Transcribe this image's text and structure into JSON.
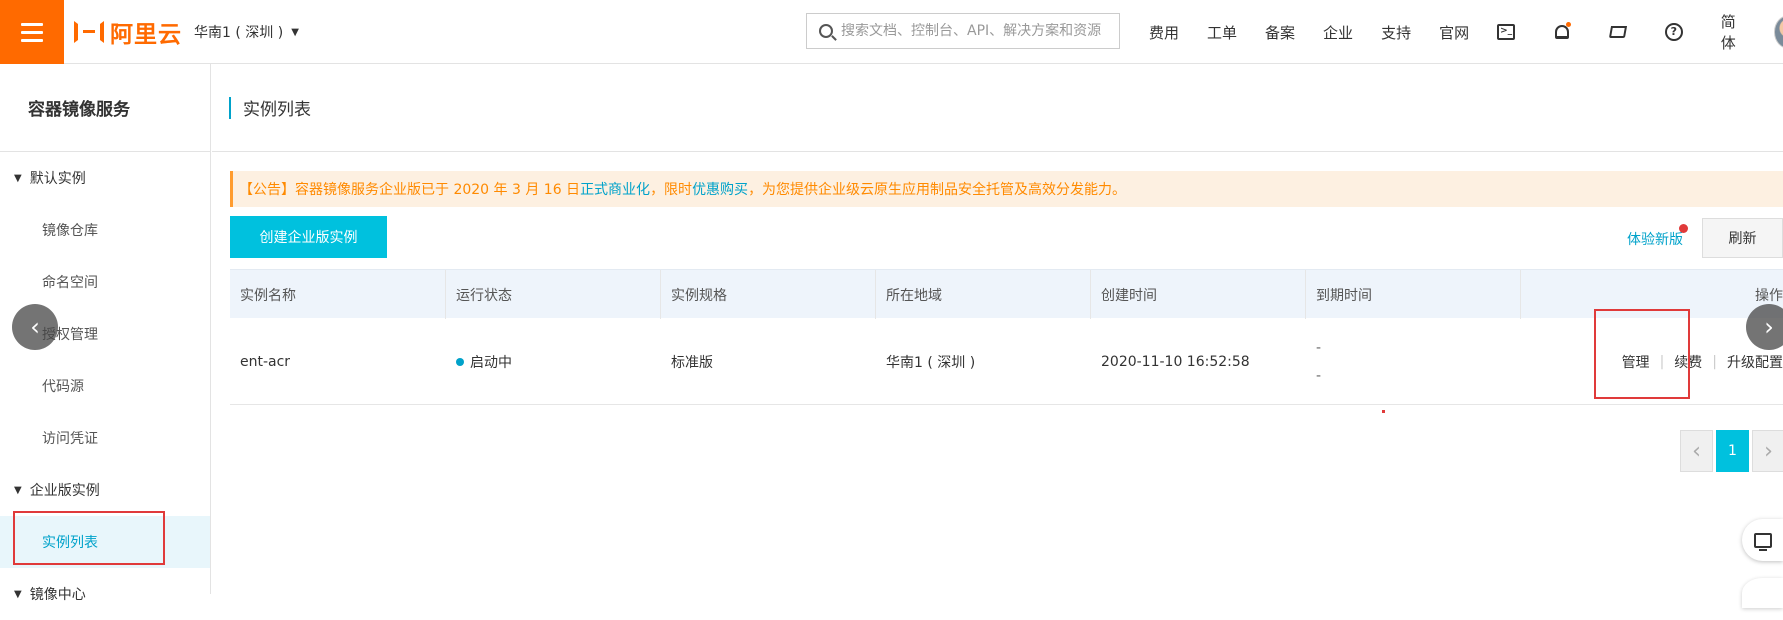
{
  "topbar": {
    "logo_text": "阿里云",
    "region": "华南1 ( 深圳 )",
    "search_placeholder": "搜索文档、控制台、API、解决方案和资源",
    "nav": [
      "费用",
      "工单",
      "备案",
      "企业",
      "支持",
      "官网"
    ],
    "terminal_glyph": ">_",
    "help_glyph": "?",
    "language": "简体"
  },
  "sidebar": {
    "title": "容器镜像服务",
    "groups": [
      {
        "label": "默认实例",
        "items": [
          "镜像仓库",
          "命名空间",
          "授权管理",
          "代码源",
          "访问凭证"
        ]
      },
      {
        "label": "企业版实例",
        "items": [
          "实例列表"
        ]
      },
      {
        "label": "镜像中心"
      }
    ],
    "active_item": "实例列表"
  },
  "main": {
    "title": "实例列表",
    "notice": {
      "prefix": "【公告】容器镜像服务企业版已于 2020 年 3 月 16 日",
      "link1": "正式商业化",
      "mid": "，限时",
      "link2": "优惠购买",
      "suffix": "，为您提供企业级云原生应用制品安全托管及高效分发能力。"
    },
    "create_button": "创建企业版实例",
    "try_new": "体验新版",
    "refresh": "刷新",
    "table": {
      "headers": [
        "实例名称",
        "运行状态",
        "实例规格",
        "所在地域",
        "创建时间",
        "到期时间",
        "操作"
      ],
      "rows": [
        {
          "name": "ent-acr",
          "status": "启动中",
          "spec": "标准版",
          "region": "华南1 ( 深圳 )",
          "created": "2020-11-10 16:52:58",
          "expiry": [
            "-",
            "-"
          ],
          "actions": [
            "管理",
            "续费",
            "升级配置"
          ]
        }
      ]
    },
    "pagination": {
      "prev": "‹",
      "current": "1",
      "next": "›"
    }
  },
  "carousel": {
    "prev": "‹",
    "next": "›"
  },
  "colors": {
    "brand": "#ff6a00",
    "accent": "#00c1de",
    "link": "#00a2ca",
    "highlight_box": "#e03a3a"
  }
}
